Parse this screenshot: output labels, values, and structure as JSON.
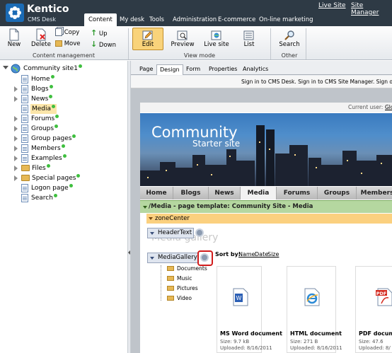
{
  "app": {
    "logo_name": "Kentico",
    "logo_sub": "CMS Desk",
    "top_links": [
      "Live Site",
      "Site Manager"
    ]
  },
  "main_tabs": [
    "Content",
    "My desk",
    "Tools",
    "Administration",
    "E-commerce",
    "On-line marketing"
  ],
  "toolbar": {
    "new": "New",
    "delete": "Delete",
    "copy": "Copy",
    "move": "Move",
    "up": "Up",
    "down": "Down",
    "group_content": "Content management",
    "edit": "Edit",
    "preview": "Preview",
    "live_site": "Live site",
    "list": "List",
    "group_view": "View mode",
    "search": "Search",
    "group_other": "Other"
  },
  "tree": {
    "root": "Community site1",
    "items": [
      "Home",
      "Blogs",
      "News",
      "Media",
      "Forums",
      "Groups",
      "Group pages",
      "Members",
      "Examples",
      "Files",
      "Special pages",
      "Logon page",
      "Search"
    ]
  },
  "view_tabs": [
    "Page",
    "Design",
    "Form",
    "Properties",
    "Analytics"
  ],
  "signbar": {
    "text": "Sign in to CMS Desk. Sign in to CMS Site Manager. Sign ou"
  },
  "site": {
    "current_user": "Current user:",
    "current_user_name": "Glo",
    "banner_title": "Community",
    "banner_sub": "Starter site",
    "nav": [
      "Home",
      "Blogs",
      "News",
      "Media",
      "Forums",
      "Groups",
      "Members"
    ],
    "page_template": "/Media - page template: Community Site - Media",
    "zone": "zoneCenter",
    "header_webpart": "HeaderText",
    "header_ghost": "Media gallery",
    "gallery_webpart": "MediaGallery",
    "sort_by": "Sort by:",
    "sort_options": [
      "Name",
      "Date",
      "Size"
    ],
    "folders": [
      "Documents",
      "Music",
      "Pictures",
      "Video"
    ],
    "files": [
      {
        "name": "MS Word document",
        "size": "Size: 9.7 kB",
        "uploaded": "Uploaded: 8/16/2011"
      },
      {
        "name": "HTML document",
        "size": "Size: 271 B",
        "uploaded": "Uploaded: 8/16/2011"
      },
      {
        "name": "PDF docum",
        "size": "Size: 47.6",
        "uploaded": "Uploaded: 8/"
      }
    ]
  },
  "colors": {
    "topbar": "#2e3a45",
    "selected": "#fbe5a9",
    "template_bar": "#b5d7a0",
    "zone_bar": "#fbd07f",
    "highlight": "#d11b1b"
  }
}
